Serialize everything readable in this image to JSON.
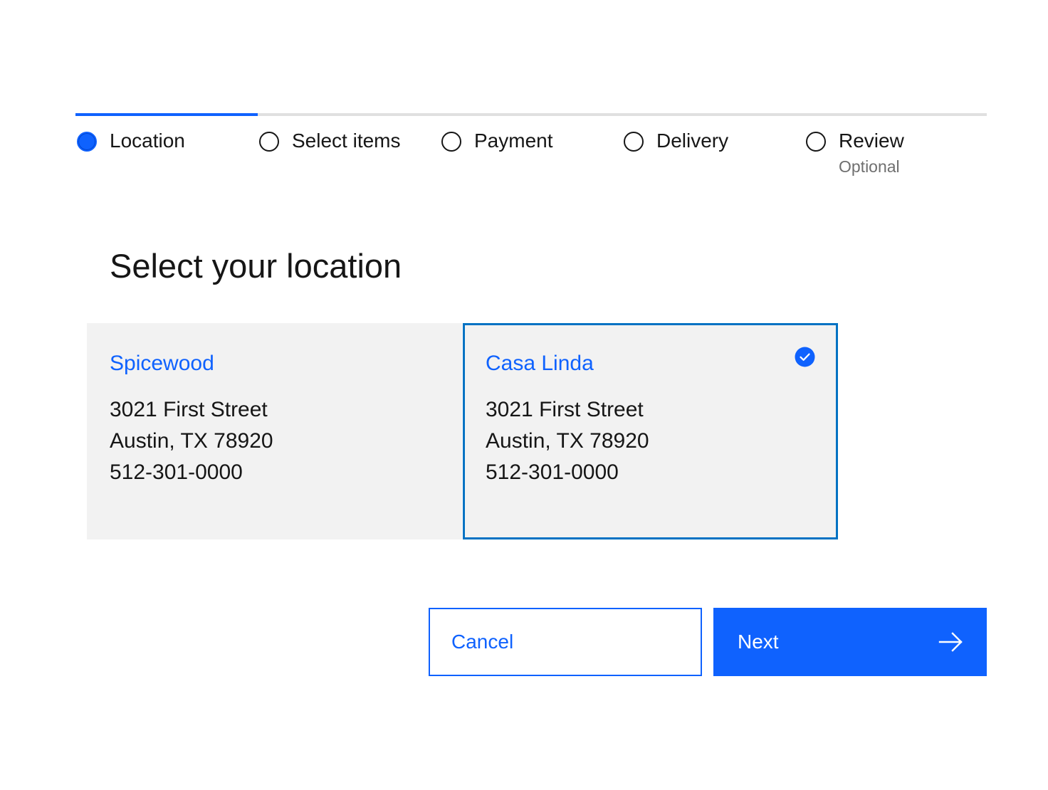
{
  "progress": {
    "steps": [
      {
        "label": "Location",
        "sublabel": "",
        "state": "current"
      },
      {
        "label": "Select items",
        "sublabel": "",
        "state": "incomplete"
      },
      {
        "label": "Payment",
        "sublabel": "",
        "state": "incomplete"
      },
      {
        "label": "Delivery",
        "sublabel": "",
        "state": "incomplete"
      },
      {
        "label": "Review",
        "sublabel": "Optional",
        "state": "incomplete"
      }
    ]
  },
  "page": {
    "title": "Select your location"
  },
  "locations": [
    {
      "name": "Spicewood",
      "address_line1": "3021 First Street",
      "address_line2": "Austin, TX 78920",
      "phone": "512-301-0000",
      "selected": false
    },
    {
      "name": "Casa Linda",
      "address_line1": "3021 First Street",
      "address_line2": "Austin, TX 78920",
      "phone": "512-301-0000",
      "selected": true,
      "icon": "checkmark-filled-icon"
    }
  ],
  "actions": {
    "cancel_label": "Cancel",
    "next_label": "Next",
    "next_icon": "arrow-right-icon"
  },
  "colors": {
    "accent": "#0f62fe",
    "selected_border": "#0072c3",
    "tile_background": "#f2f2f2",
    "text_primary": "#161616",
    "text_secondary": "#6f6f6f",
    "track": "#e0e0e0"
  }
}
